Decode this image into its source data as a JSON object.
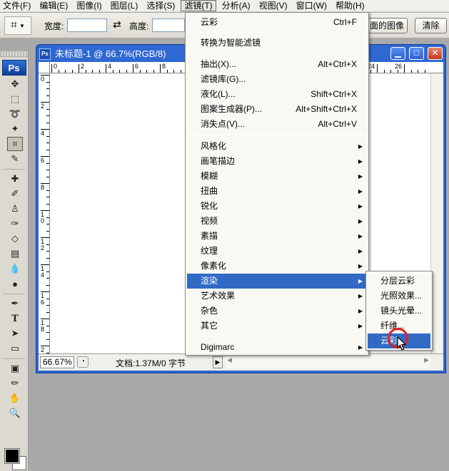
{
  "menubar": {
    "items": [
      {
        "label": "文件(F)"
      },
      {
        "label": "编辑(E)"
      },
      {
        "label": "图像(I)"
      },
      {
        "label": "图层(L)"
      },
      {
        "label": "选择(S)"
      },
      {
        "label": "滤镜(T)"
      },
      {
        "label": "分析(A)"
      },
      {
        "label": "视图(V)"
      },
      {
        "label": "窗口(W)"
      },
      {
        "label": "帮助(H)"
      }
    ]
  },
  "options_bar": {
    "width_label": "宽度:",
    "width_value": "",
    "height_label": "高度:",
    "height_value": "",
    "front_image_button": "前面的图像",
    "front_image_visible": "面的图像",
    "clear_button": "清除"
  },
  "toolbox": {
    "logo": "Ps"
  },
  "document": {
    "title": "未标题-1 @ 66.7%(RGB/8)",
    "icon_text": "Ps",
    "zoom": "66.67%",
    "doc_info": "文档:1.37M/0 字节",
    "ruler_top_numbers": [
      "0",
      "2",
      "4",
      "6",
      "8",
      "24",
      "26"
    ],
    "ruler_left_numbers": [
      "0",
      "2",
      "4",
      "6",
      "8",
      "1 0",
      "1 2",
      "1 4",
      "1 6",
      "1 8",
      "2 0"
    ]
  },
  "filter_menu": {
    "last_filter": {
      "label": "云彩",
      "shortcut": "Ctrl+F"
    },
    "smart": "转换为智能滤镜",
    "group1": [
      {
        "label": "抽出(X)...",
        "shortcut": "Alt+Ctrl+X"
      },
      {
        "label": "滤镜库(G)...",
        "shortcut": ""
      },
      {
        "label": "液化(L)...",
        "shortcut": "Shift+Ctrl+X"
      },
      {
        "label": "图案生成器(P)...",
        "shortcut": "Alt+Shift+Ctrl+X"
      },
      {
        "label": "消失点(V)...",
        "shortcut": "Alt+Ctrl+V"
      }
    ],
    "submenus": [
      {
        "label": "风格化"
      },
      {
        "label": "画笔描边"
      },
      {
        "label": "模糊"
      },
      {
        "label": "扭曲"
      },
      {
        "label": "锐化"
      },
      {
        "label": "视频"
      },
      {
        "label": "素描"
      },
      {
        "label": "纹理"
      },
      {
        "label": "像素化"
      },
      {
        "label": "渲染"
      },
      {
        "label": "艺术效果"
      },
      {
        "label": "杂色"
      },
      {
        "label": "其它"
      }
    ],
    "digimarc": "Digimarc"
  },
  "render_submenu": {
    "items": [
      {
        "label": "分层云彩"
      },
      {
        "label": "光照效果..."
      },
      {
        "label": "镜头光晕..."
      },
      {
        "label": "纤维..."
      },
      {
        "label": "云彩"
      }
    ]
  },
  "colors": {
    "highlight": "#316ac5",
    "titlebar": "#2f68d2",
    "click_ring": "#e02020"
  }
}
